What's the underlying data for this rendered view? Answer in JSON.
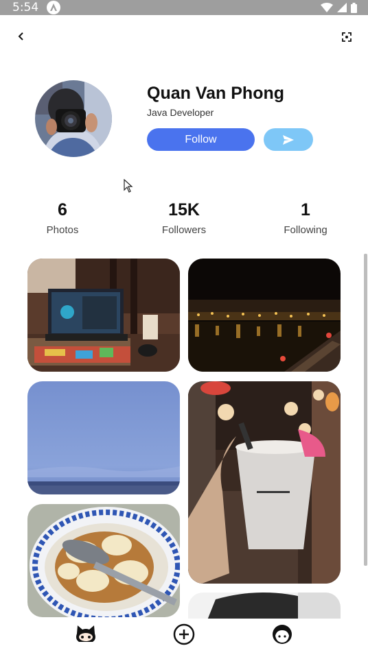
{
  "status_bar": {
    "time": "5:54",
    "icons": [
      "notification-icon",
      "wifi-icon",
      "signal-icon",
      "battery-icon"
    ]
  },
  "toolbar": {
    "back_icon": "chevron-left-icon",
    "scan_icon": "scan-icon"
  },
  "profile": {
    "name": "Quan Van Phong",
    "role": "Java Developer",
    "follow_label": "Follow",
    "send_icon": "send-icon"
  },
  "stats": [
    {
      "value": "6",
      "label": "Photos"
    },
    {
      "value": "15K",
      "label": "Followers"
    },
    {
      "value": "1",
      "label": "Following"
    }
  ],
  "gallery": {
    "photos": [
      "laptop-desk-photo",
      "night-river-photo",
      "sky-beach-photo",
      "cup-street-photo",
      "tofu-bowl-photo",
      "portrait-photo"
    ]
  },
  "bottom_nav": {
    "items": [
      "github-octocat-icon",
      "add-circle-icon",
      "avatar-face-icon"
    ]
  },
  "colors": {
    "primary": "#4a73ee",
    "secondary": "#7ec7f7",
    "status_bar": "#9e9e9e"
  }
}
